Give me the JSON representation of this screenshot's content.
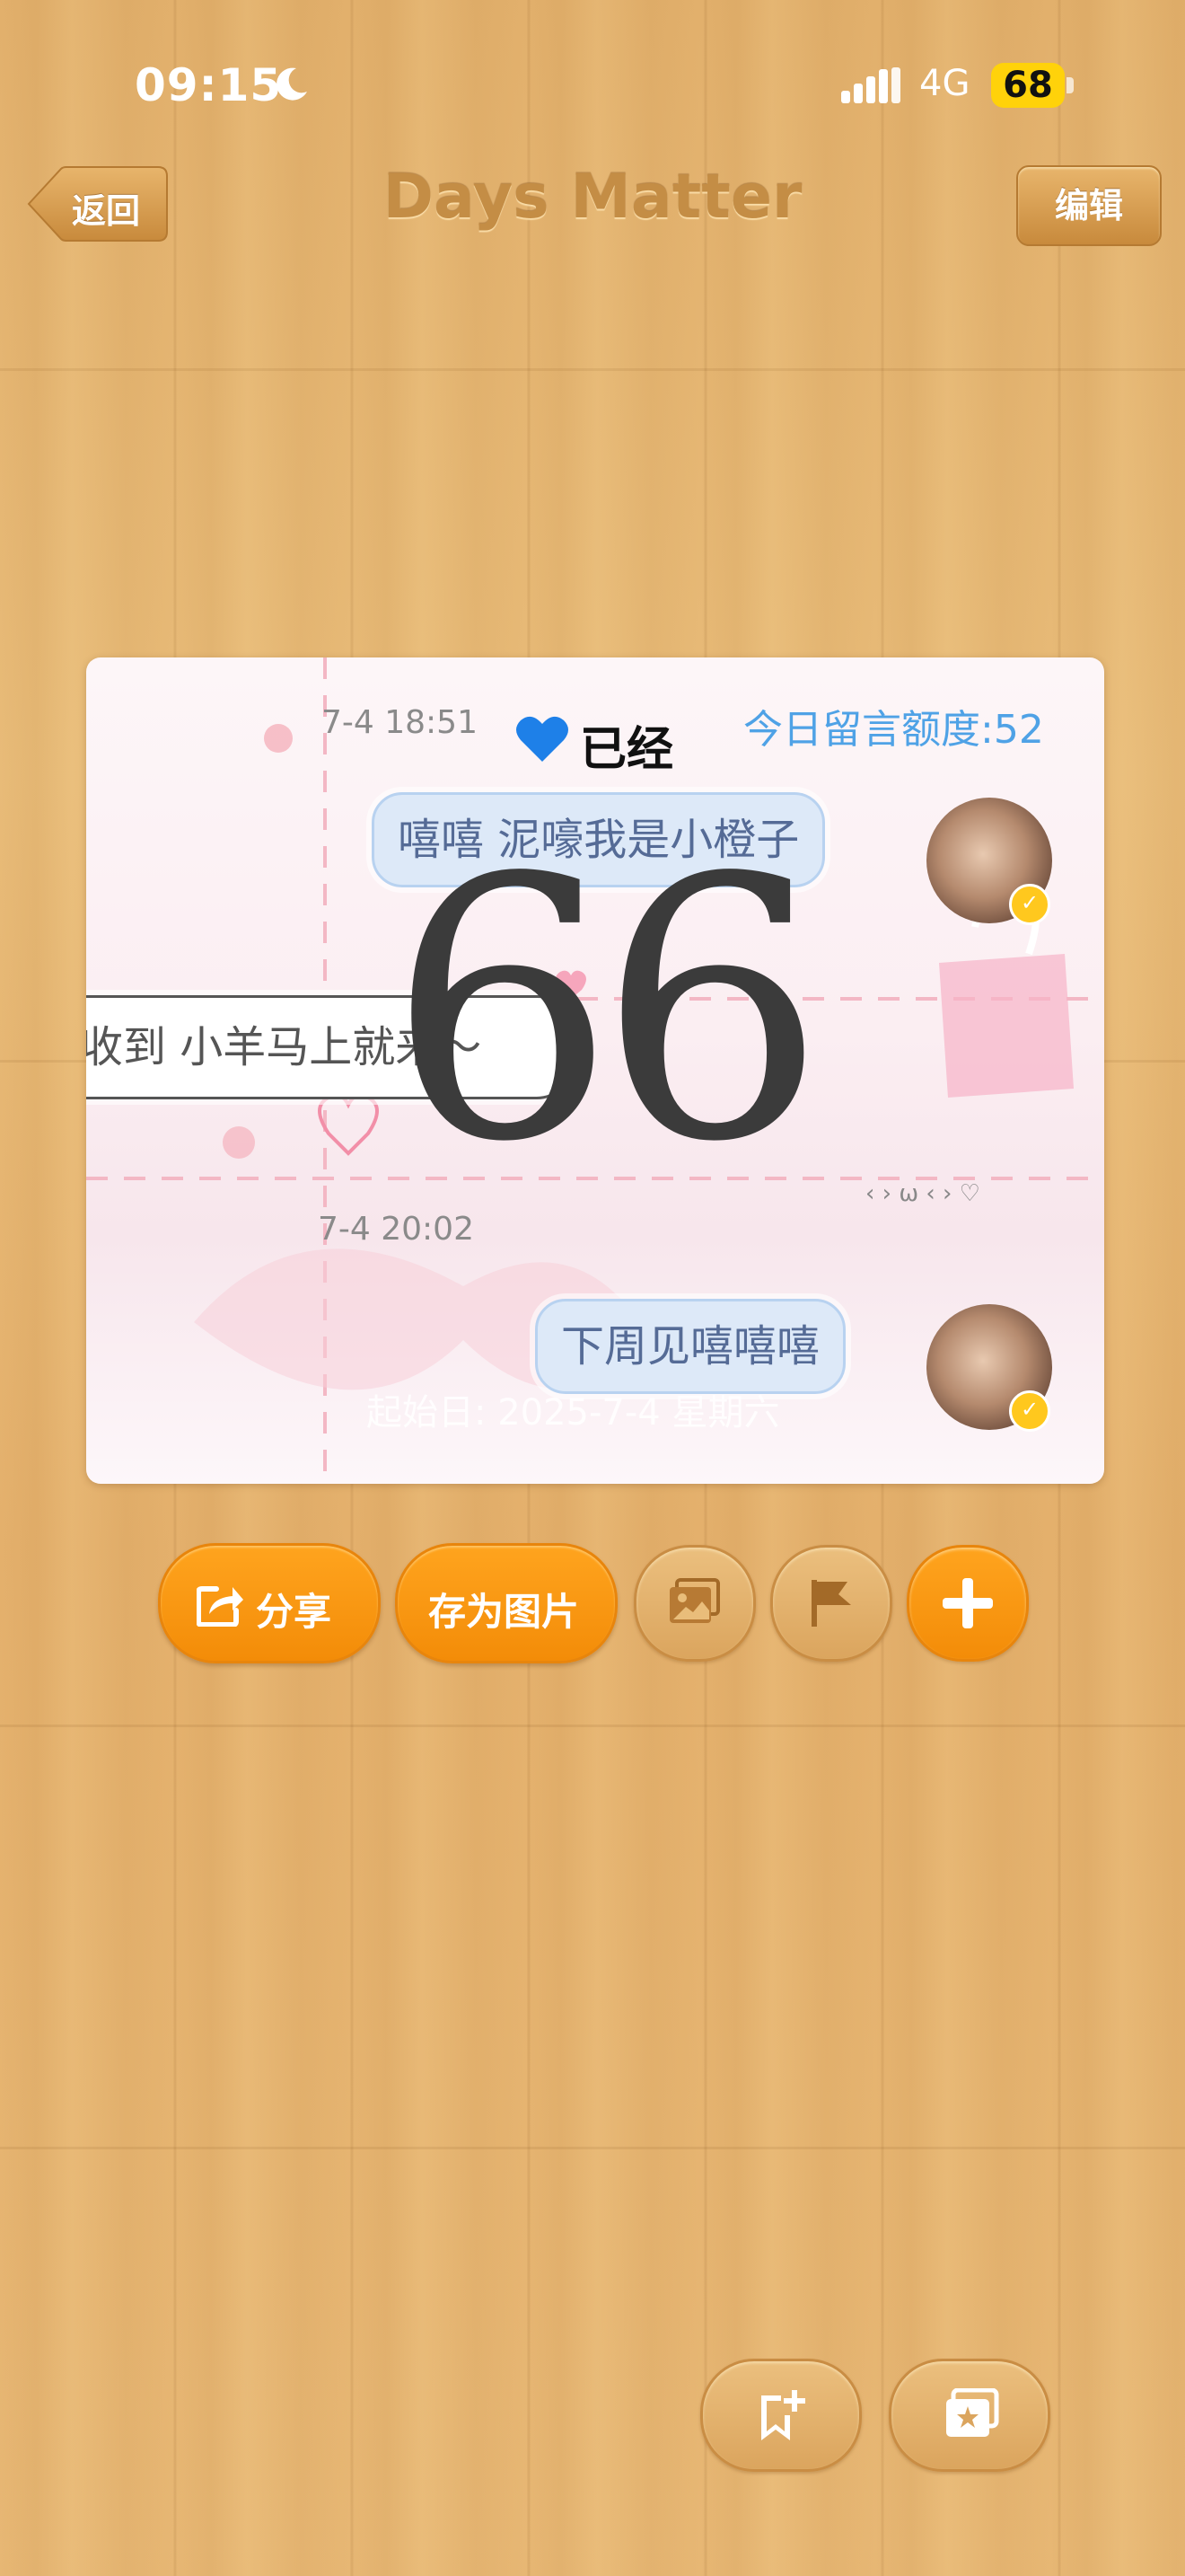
{
  "status_bar": {
    "time": "09:15",
    "network": "4G",
    "battery": "68"
  },
  "nav": {
    "back_label": "返回",
    "title": "Days Matter",
    "edit_label": "编辑"
  },
  "card": {
    "timestamp_1": "7-4 18:51",
    "already_label": "已经",
    "quota_label": "今日留言额度:52",
    "message_right_1": "嘻嘻 泥嚎我是小橙子",
    "message_left_1": "收到 小羊马上就来～",
    "timestamp_2": "7-4 20:02",
    "message_right_2": "下周见嘻嘻嘻",
    "day_count": "66",
    "start_date": "起始日: 2025-7-4 星期六"
  },
  "actions": {
    "share_label": "分享",
    "save_image_label": "存为图片",
    "icons": [
      "share-icon",
      "photo-icon",
      "flag-icon",
      "plus-icon",
      "bookmark-add-icon",
      "photo-stack-icon"
    ]
  },
  "colors": {
    "accent_orange": "#f7960f",
    "wood_base": "#e4b06c",
    "quota_blue": "#4fa2e6",
    "title_brown": "#c48d45"
  }
}
